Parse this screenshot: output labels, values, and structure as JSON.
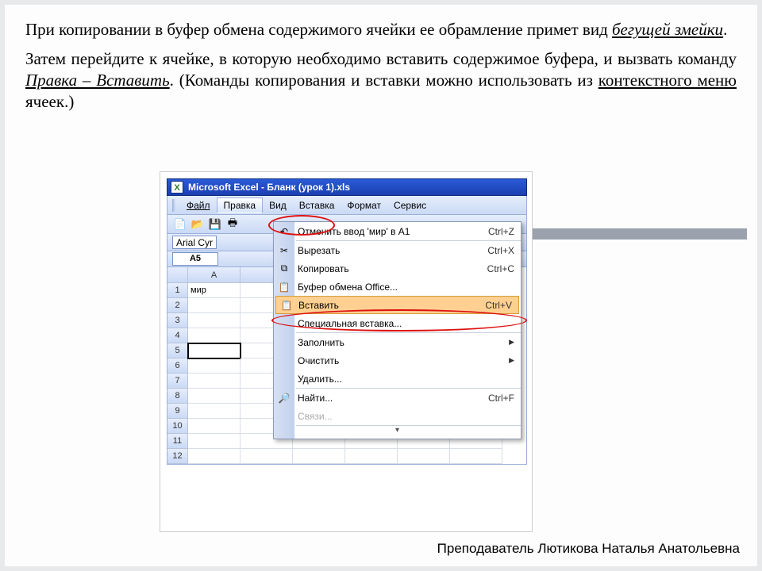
{
  "para1": {
    "t1": "При копировании в буфер обмена содержимого ячейки ее обрамление примет вид ",
    "em1": "бегущей змейки",
    "t2": "."
  },
  "para2": {
    "t1": "Затем перейдите к ячейке, в которую необходимо вставить содержимое буфера, и вызвать команду ",
    "em1": "Правка – Вставить",
    "t2": ". (Команды копирования и вставки можно использовать из ",
    "em2": "контекстного меню",
    "t3": " ячеек.)"
  },
  "titlebar": "Microsoft Excel - Бланк (урок 1).xls",
  "menu": {
    "file": "Файл",
    "edit": "Правка",
    "view": "Вид",
    "insert": "Вставка",
    "format": "Формат",
    "service": "Сервис"
  },
  "font": "Arial Cyr",
  "namebox": "A5",
  "colA": "A",
  "cellA1": "мир",
  "rows": [
    "1",
    "2",
    "3",
    "4",
    "5",
    "6",
    "7",
    "8",
    "9",
    "10",
    "11",
    "12"
  ],
  "dd": {
    "undo": {
      "label": "Отменить ввод 'мир' в A1",
      "shortcut": "Ctrl+Z"
    },
    "cut": {
      "label": "Вырезать",
      "shortcut": "Ctrl+X"
    },
    "copy": {
      "label": "Копировать",
      "shortcut": "Ctrl+C"
    },
    "clipboard": {
      "label": "Буфер обмена Office..."
    },
    "paste": {
      "label": "Вставить",
      "shortcut": "Ctrl+V"
    },
    "pastespec": {
      "label": "Специальная вставка..."
    },
    "fill": {
      "label": "Заполнить"
    },
    "clear": {
      "label": "Очистить"
    },
    "delete": {
      "label": "Удалить..."
    },
    "find": {
      "label": "Найти...",
      "shortcut": "Ctrl+F"
    },
    "links": {
      "label": "Связи..."
    }
  },
  "footer": "Преподаватель Лютикова Наталья Анатольевна"
}
